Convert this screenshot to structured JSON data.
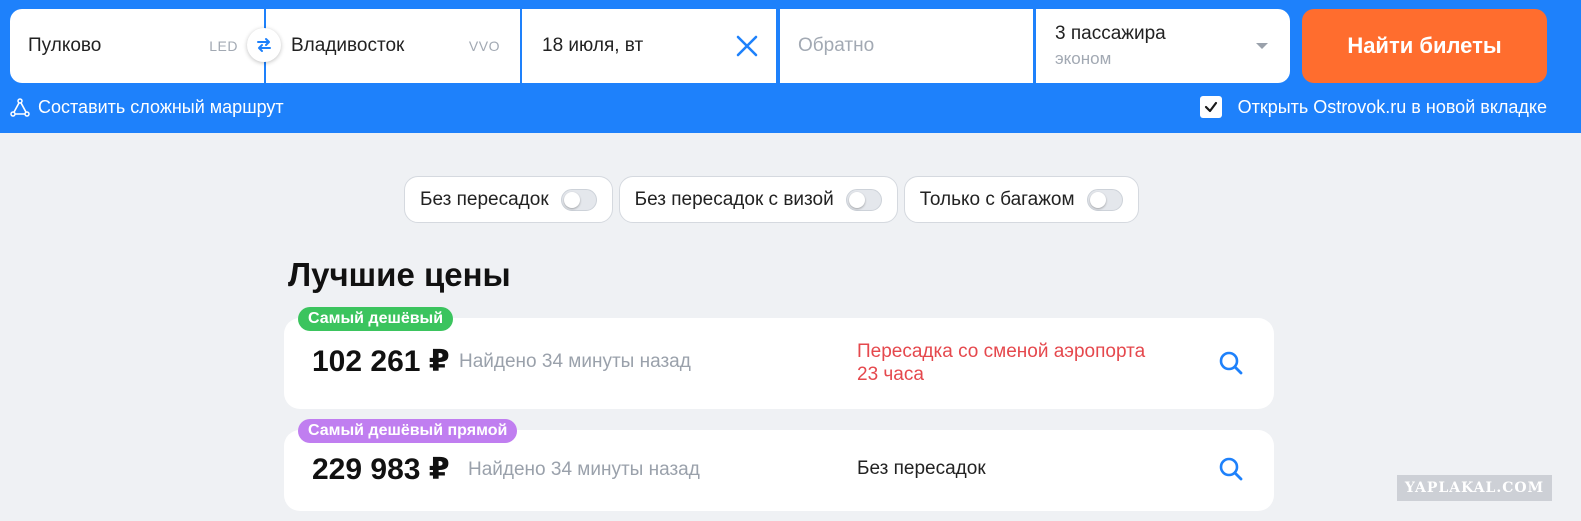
{
  "search": {
    "origin": {
      "name": "Пулково",
      "code": "LED"
    },
    "destination": {
      "name": "Владивосток",
      "code": "VVO"
    },
    "date": "18 июля, вт",
    "return_placeholder": "Обратно",
    "passengers": {
      "count": "3 пассажира",
      "class": "эконом"
    },
    "search_button": "Найти билеты"
  },
  "links": {
    "complex_route": "Составить сложный маршрут",
    "open_new_tab": "Открыть Ostrovok.ru в новой вкладке"
  },
  "filters": [
    {
      "label": "Без пересадок"
    },
    {
      "label": "Без пересадок с визой"
    },
    {
      "label": "Только с багажом"
    }
  ],
  "best_prices": {
    "title": "Лучшие цены",
    "cards": [
      {
        "badge": "Самый дешёвый",
        "price": "102 261 ₽",
        "found": "Найдено 34 минуты назад",
        "note_line1": "Пересадка со сменой аэропорта",
        "note_line2": "23 часа"
      },
      {
        "badge": "Самый дешёвый прямой",
        "price": "229 983 ₽",
        "found": "Найдено 34 минуты назад",
        "note_line1": "Без пересадок"
      }
    ]
  },
  "watermark": "YAPLAKAL.COM",
  "colors": {
    "header": "#1e81fb",
    "search_button": "#ff6d2e",
    "badge_green": "#3bc45e",
    "badge_purple": "#c07ef0",
    "note_red": "#e5484d"
  }
}
